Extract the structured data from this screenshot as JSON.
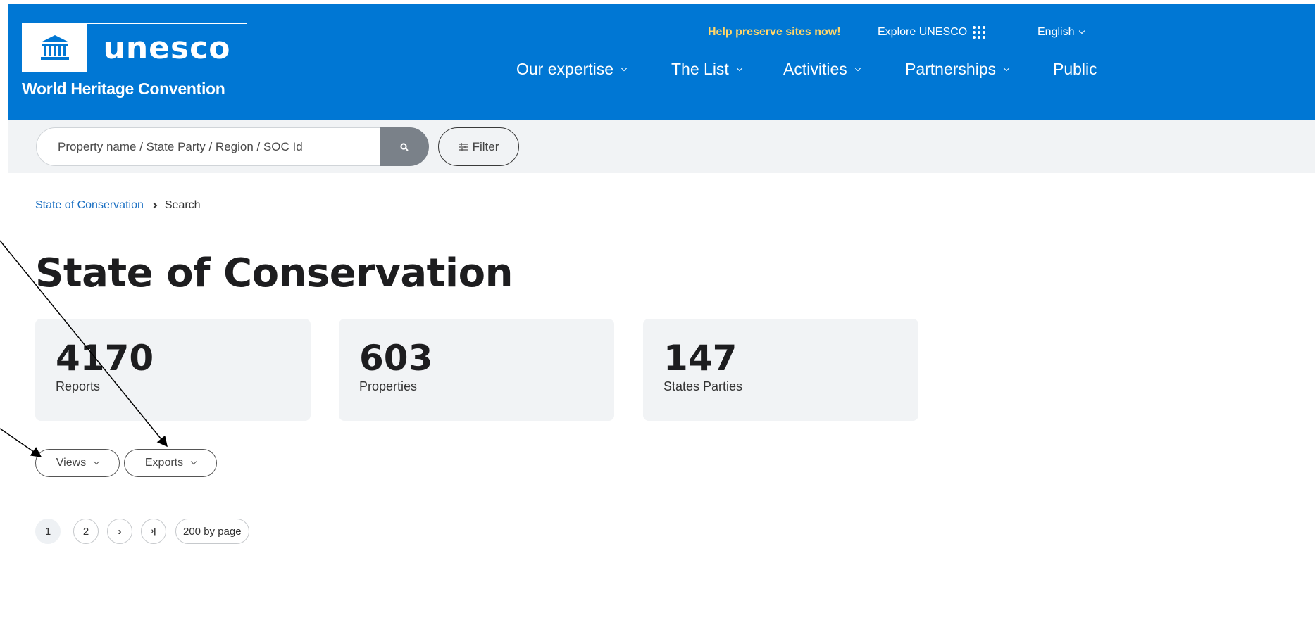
{
  "header": {
    "logo_word": "unesco",
    "logo_subtitle": "World Heritage Convention",
    "help_link": "Help preserve sites now!",
    "explore_link": "Explore UNESCO",
    "language": "English",
    "nav": [
      "Our expertise",
      "The List",
      "Activities",
      "Partnerships",
      "Public"
    ],
    "bg_color": "#0077d4",
    "help_color": "#ffd66b"
  },
  "search": {
    "placeholder": "Property name / State Party / Region / SOC Id",
    "filter_label": "Filter",
    "search_icon": "search-icon",
    "filter_icon": "sliders-icon"
  },
  "breadcrumb": {
    "parent": "State of Conservation",
    "current": "Search"
  },
  "page_title": "State of Conservation",
  "stats": [
    {
      "value": "4170",
      "label": "Reports"
    },
    {
      "value": "603",
      "label": "Properties"
    },
    {
      "value": "147",
      "label": "States Parties"
    }
  ],
  "actions": {
    "views": "Views",
    "exports": "Exports"
  },
  "pagination": {
    "pages": [
      "1",
      "2"
    ],
    "current": "1",
    "next": "›",
    "last": "›|",
    "per_page": "200 by page"
  }
}
